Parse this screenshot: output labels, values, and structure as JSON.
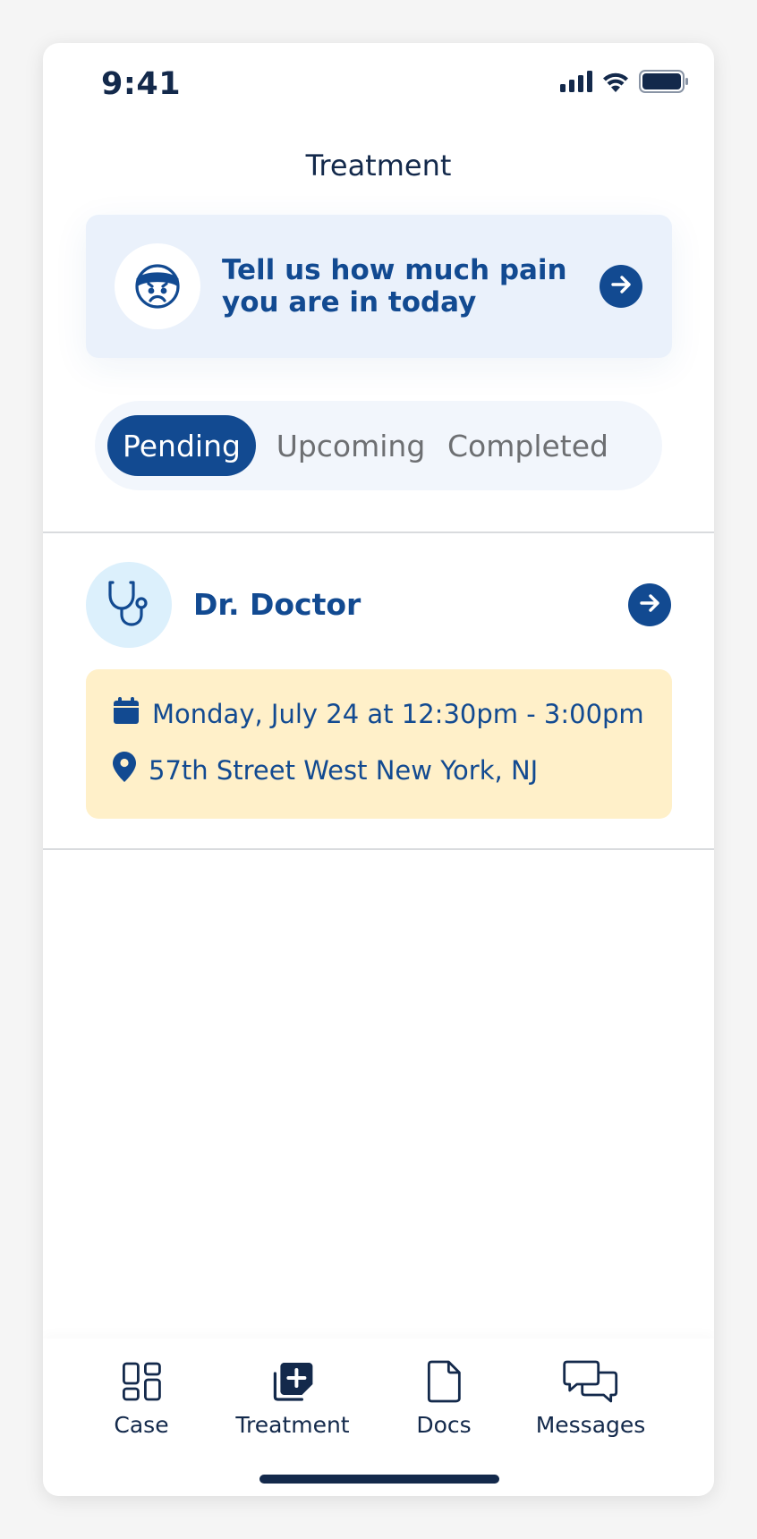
{
  "status_bar": {
    "time": "9:41"
  },
  "header": {
    "title": "Treatment"
  },
  "pain_prompt": {
    "text": "Tell us how much pain you are in today"
  },
  "tabs": [
    {
      "label": "Pending",
      "active": true
    },
    {
      "label": "Upcoming",
      "active": false
    },
    {
      "label": "Completed",
      "active": false
    }
  ],
  "appointment": {
    "doctor": "Dr. Doctor",
    "datetime": "Monday, July 24 at 12:30pm - 3:00pm",
    "location": "57th Street West New York, NJ"
  },
  "bottom_nav": [
    {
      "label": "Case",
      "icon": "case-grid-icon"
    },
    {
      "label": "Treatment",
      "icon": "treatment-plus-icon",
      "active": true
    },
    {
      "label": "Docs",
      "icon": "document-icon"
    },
    {
      "label": "Messages",
      "icon": "messages-icon"
    }
  ],
  "colors": {
    "primary": "#124a91",
    "text_dark": "#13294b",
    "pain_card_bg": "#eaf1fb",
    "appointment_bg": "#fff0c9",
    "doctor_avatar_bg": "#dcf0fc"
  }
}
